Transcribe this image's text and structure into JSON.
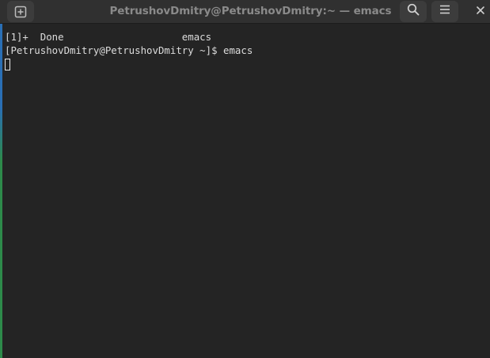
{
  "window": {
    "title": "PetrushovDmitry@PetrushovDmitry:~ — emacs"
  },
  "titlebar": {
    "new_tab_icon": "new-tab-icon",
    "search_icon": "search-icon",
    "menu_icon": "hamburger-menu-icon",
    "close_icon": "close-icon"
  },
  "terminal": {
    "lines": [
      "[1]+  Done                    emacs",
      "[PetrushovDmitry@PetrushovDmitry ~]$ emacs"
    ]
  },
  "colors": {
    "terminal_background": "#242424",
    "titlebar_background": "#303030",
    "text": "#dcdcdc",
    "title_text": "#8a8a8a"
  }
}
